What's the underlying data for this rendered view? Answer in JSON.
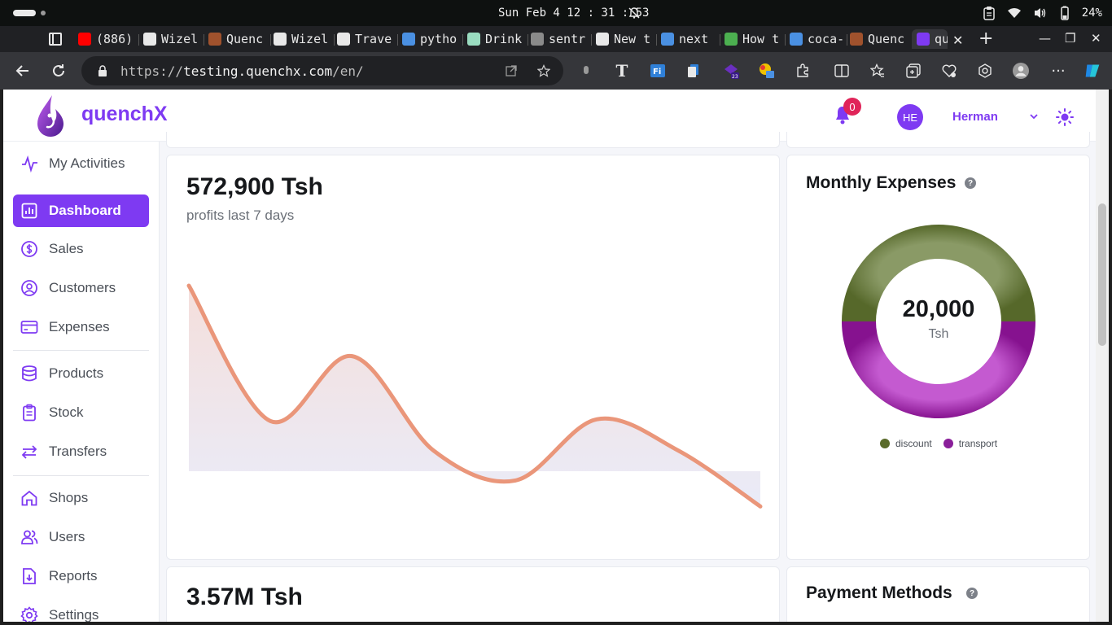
{
  "os": {
    "clock": "Sun Feb 4 12 : 31 : 53",
    "battery": "24%"
  },
  "browser": {
    "tabs": [
      {
        "label": "(886)",
        "icon": "youtube-icon",
        "color": "#ff0000"
      },
      {
        "label": "Wizel",
        "icon": "github-icon",
        "color": "#e8e8e8"
      },
      {
        "label": "Quenc",
        "icon": "quenchx-tab-icon",
        "color": "#a0522d"
      },
      {
        "label": "Wizel",
        "icon": "github-icon",
        "color": "#e8e8e8"
      },
      {
        "label": "Trave",
        "icon": "triangle-icon",
        "color": "#e8e8e8"
      },
      {
        "label": "pytho",
        "icon": "search-icon",
        "color": "#4a90e2"
      },
      {
        "label": "Drink",
        "icon": "chatgpt-icon",
        "color": "#9adcc0"
      },
      {
        "label": "sentr",
        "icon": "hexagon-icon",
        "color": "#8a8a8a"
      },
      {
        "label": "New t",
        "icon": "newtab-icon",
        "color": "#e8e8e8"
      },
      {
        "label": "next",
        "icon": "search-icon",
        "color": "#4a90e2"
      },
      {
        "label": "How t",
        "icon": "infinity-icon",
        "color": "#4caf50"
      },
      {
        "label": "coca-",
        "icon": "search-icon",
        "color": "#4a90e2"
      },
      {
        "label": "Quenc",
        "icon": "quenchx-tab-icon",
        "color": "#a0522d"
      },
      {
        "label": "qu",
        "icon": "quenchx-tab-icon",
        "color": "#7e3af2"
      }
    ],
    "url_scheme": "https://",
    "url_host": "testing.quenchx.com",
    "url_path": "/en/"
  },
  "app": {
    "brand": "quenchX",
    "accent": "#7e3af2",
    "notifications_count": "0",
    "avatar_initials": "HE",
    "user_name": "Herman"
  },
  "sidebar": {
    "items": [
      {
        "label": "My Activities",
        "icon": "activity-icon",
        "active": false
      },
      {
        "label": "Dashboard",
        "icon": "bar-chart-icon",
        "active": true
      },
      {
        "label": "Sales",
        "icon": "dollar-icon",
        "active": false
      },
      {
        "label": "Customers",
        "icon": "user-circle-icon",
        "active": false
      },
      {
        "label": "Expenses",
        "icon": "credit-card-icon",
        "active": false
      },
      {
        "label": "Products",
        "icon": "database-icon",
        "active": false
      },
      {
        "label": "Stock",
        "icon": "clipboard-icon",
        "active": false
      },
      {
        "label": "Transfers",
        "icon": "arrows-icon",
        "active": false
      },
      {
        "label": "Shops",
        "icon": "home-icon",
        "active": false
      },
      {
        "label": "Users",
        "icon": "users-icon",
        "active": false
      },
      {
        "label": "Reports",
        "icon": "file-download-icon",
        "active": false
      },
      {
        "label": "Settings",
        "icon": "gear-icon",
        "active": false
      }
    ]
  },
  "profits_card": {
    "value": "572,900 Tsh",
    "label": "profits last 7 days",
    "line_color": "#ea967a"
  },
  "expenses_card": {
    "title": "Monthly Expenses",
    "total": "20,000",
    "unit": "Tsh"
  },
  "second_row": {
    "value": "3.57M Tsh",
    "payment_title": "Payment Methods"
  },
  "chart_data": [
    {
      "type": "area",
      "title": "",
      "series": [
        {
          "values": [
            100,
            27,
            62,
            11,
            -5,
            28,
            11,
            -19
          ]
        }
      ]
    },
    {
      "type": "pie",
      "title": "Monthly Expenses",
      "categories": [
        "discount",
        "transport"
      ],
      "values": [
        10000,
        10000
      ],
      "colors": [
        "#5a6b2a",
        "#8a1f9a"
      ]
    }
  ]
}
